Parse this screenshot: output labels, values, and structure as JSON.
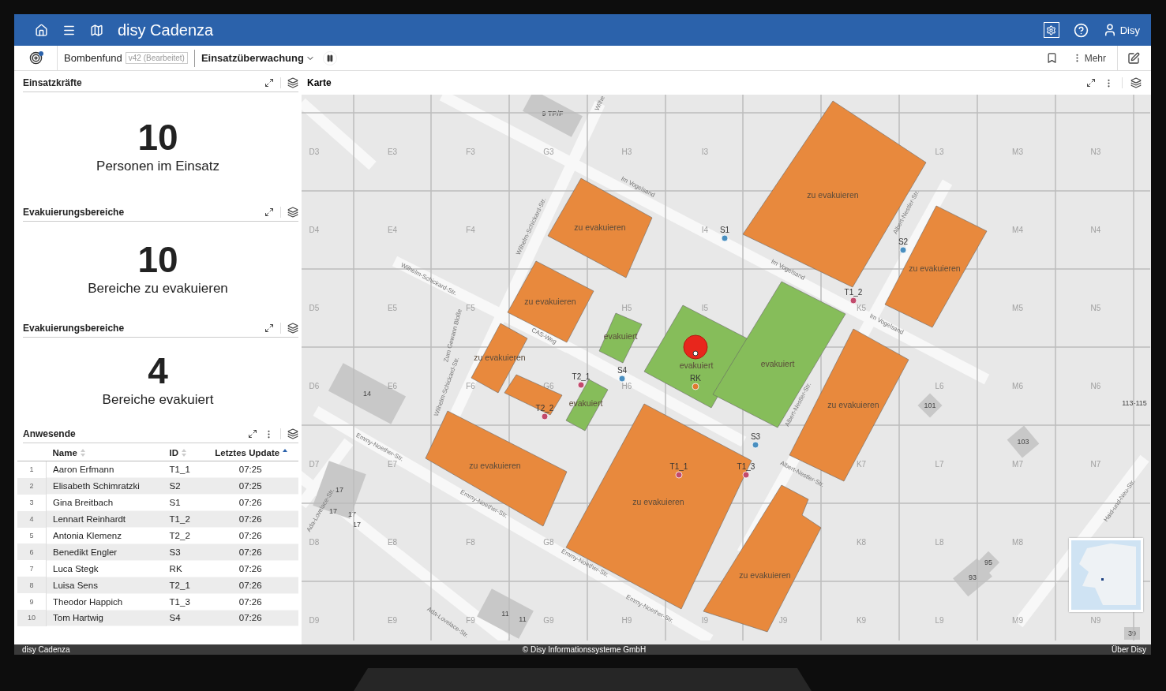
{
  "header": {
    "app_title": "disy Cadenza",
    "user": "Disy"
  },
  "toolbar": {
    "document": "Bombenfund",
    "version": "v42 (Bearbeitet)",
    "view": "Einsatzüberwachung",
    "more": "Mehr",
    "notification": true
  },
  "kpis": [
    {
      "title": "Einsatzkräfte",
      "value": "10",
      "caption": "Personen im Einsatz"
    },
    {
      "title": "Evakuierungsbereiche",
      "value": "10",
      "caption": "Bereiche zu evakuieren"
    },
    {
      "title": "Evakuierungsbereiche",
      "value": "4",
      "caption": "Bereiche evakuiert"
    }
  ],
  "table": {
    "title": "Anwesende",
    "columns": [
      {
        "label": "Name",
        "sorted": false
      },
      {
        "label": "ID",
        "sorted": false
      },
      {
        "label": "Letztes Update",
        "sorted": true
      }
    ],
    "rows": [
      {
        "index": "1",
        "cells": [
          "Aaron Erfmann",
          "T1_1",
          "07:25"
        ]
      },
      {
        "index": "2",
        "cells": [
          "Elisabeth Schimratzki",
          "S2",
          "07:25"
        ]
      },
      {
        "index": "3",
        "cells": [
          "Gina Breitbach",
          "S1",
          "07:26"
        ]
      },
      {
        "index": "4",
        "cells": [
          "Lennart Reinhardt",
          "T1_2",
          "07:26"
        ]
      },
      {
        "index": "5",
        "cells": [
          "Antonia Klemenz",
          "T2_2",
          "07:26"
        ]
      },
      {
        "index": "6",
        "cells": [
          "Benedikt Engler",
          "S3",
          "07:26"
        ]
      },
      {
        "index": "7",
        "cells": [
          "Luca Stegk",
          "RK",
          "07:26"
        ]
      },
      {
        "index": "8",
        "cells": [
          "Luisa Sens",
          "T2_1",
          "07:26"
        ]
      },
      {
        "index": "9",
        "cells": [
          "Theodor Happich",
          "T1_3",
          "07:26"
        ]
      },
      {
        "index": "10",
        "cells": [
          "Tom Hartwig",
          "S4",
          "07:26"
        ]
      }
    ]
  },
  "map": {
    "title": "Karte",
    "grid": [
      [
        "D3",
        "E3",
        "F3",
        "G3",
        "H3",
        "I3",
        "L3",
        "M3",
        "N3"
      ],
      [
        "D4",
        "E4",
        "F4",
        "I4",
        "M4",
        "N4"
      ],
      [
        "D5",
        "E5",
        "F5",
        "H5",
        "I5",
        "K5",
        "M5",
        "N5"
      ],
      [
        "D6",
        "E6",
        "F6",
        "G6",
        "H6",
        "L6",
        "M6",
        "N6"
      ],
      [
        "D7",
        "E7",
        "K7",
        "L7",
        "M7",
        "N7"
      ],
      [
        "D8",
        "E8",
        "F8",
        "G8",
        "K8",
        "L8",
        "M8"
      ],
      [
        "D9",
        "E9",
        "F9",
        "G9",
        "H9",
        "I9",
        "J9",
        "K9",
        "L9",
        "M9",
        "N9"
      ]
    ],
    "streets": [
      "Wilhe",
      "Im Vogelsand",
      "Im Vogelsand",
      "Im Vogelsand",
      "Wilhelm-Schickard-Str.",
      "Wilhelm-Schickard-Str.",
      "Zum Gewann Bloße",
      "CAS-Weg",
      "Wilhelm-Schickard-Str.",
      "Albert-Nestler-Str.",
      "Albert-Nestler-Str.",
      "Albert-Nestler-Str.",
      "Emmy-Noether-Str.",
      "Emmy-Noether-Str.",
      "Emmy-Noether-Str.",
      "Emmy-Noether-Str.",
      "Ada-Lovelace-Str.",
      "Ada-Lovelace-Str.",
      "Haid-und-Neu-Str."
    ],
    "buildings": [
      "9 TP/F",
      "14",
      "101",
      "103",
      "113-115",
      "95",
      "93",
      "39",
      "11",
      "11",
      "17",
      "17",
      "17",
      "17"
    ],
    "areas": [
      {
        "label": "zu evakuieren",
        "kind": "pending"
      },
      {
        "label": "zu evakuieren",
        "kind": "pending"
      },
      {
        "label": "zu evakuieren",
        "kind": "pending"
      },
      {
        "label": "zu evakuieren",
        "kind": "pending"
      },
      {
        "label": "zu evakuieren",
        "kind": "pending"
      },
      {
        "kind": "pending"
      },
      {
        "label": "zu evakuieren",
        "kind": "pending"
      },
      {
        "label": "zu evakuieren",
        "kind": "pending"
      },
      {
        "label": "zu evakuieren",
        "kind": "pending"
      },
      {
        "label": "zu evakuieren",
        "kind": "pending"
      },
      {
        "label": "evakuiert",
        "kind": "done"
      },
      {
        "label": "evakuiert",
        "kind": "done"
      },
      {
        "label": "evakuiert",
        "kind": "done"
      },
      {
        "label": "evakuiert",
        "kind": "done"
      }
    ],
    "units": [
      {
        "label": "S1",
        "color": "#4a8fc0"
      },
      {
        "label": "S2",
        "color": "#4a8fc0"
      },
      {
        "label": "S3",
        "color": "#4a8fc0"
      },
      {
        "label": "S4",
        "color": "#4a8fc0"
      },
      {
        "label": "T1_1",
        "color": "#c24a6c"
      },
      {
        "label": "T1_2",
        "color": "#c24a6c"
      },
      {
        "label": "T1_3",
        "color": "#c24a6c"
      },
      {
        "label": "T2_1",
        "color": "#c24a6c"
      },
      {
        "label": "T2_2",
        "color": "#c24a6c"
      },
      {
        "label": "RK",
        "color": "#e07a30"
      }
    ],
    "bomb": true
  },
  "footer": {
    "left": "disy Cadenza",
    "center": "© Disy Informationssysteme GmbH",
    "right": "Über Disy"
  }
}
